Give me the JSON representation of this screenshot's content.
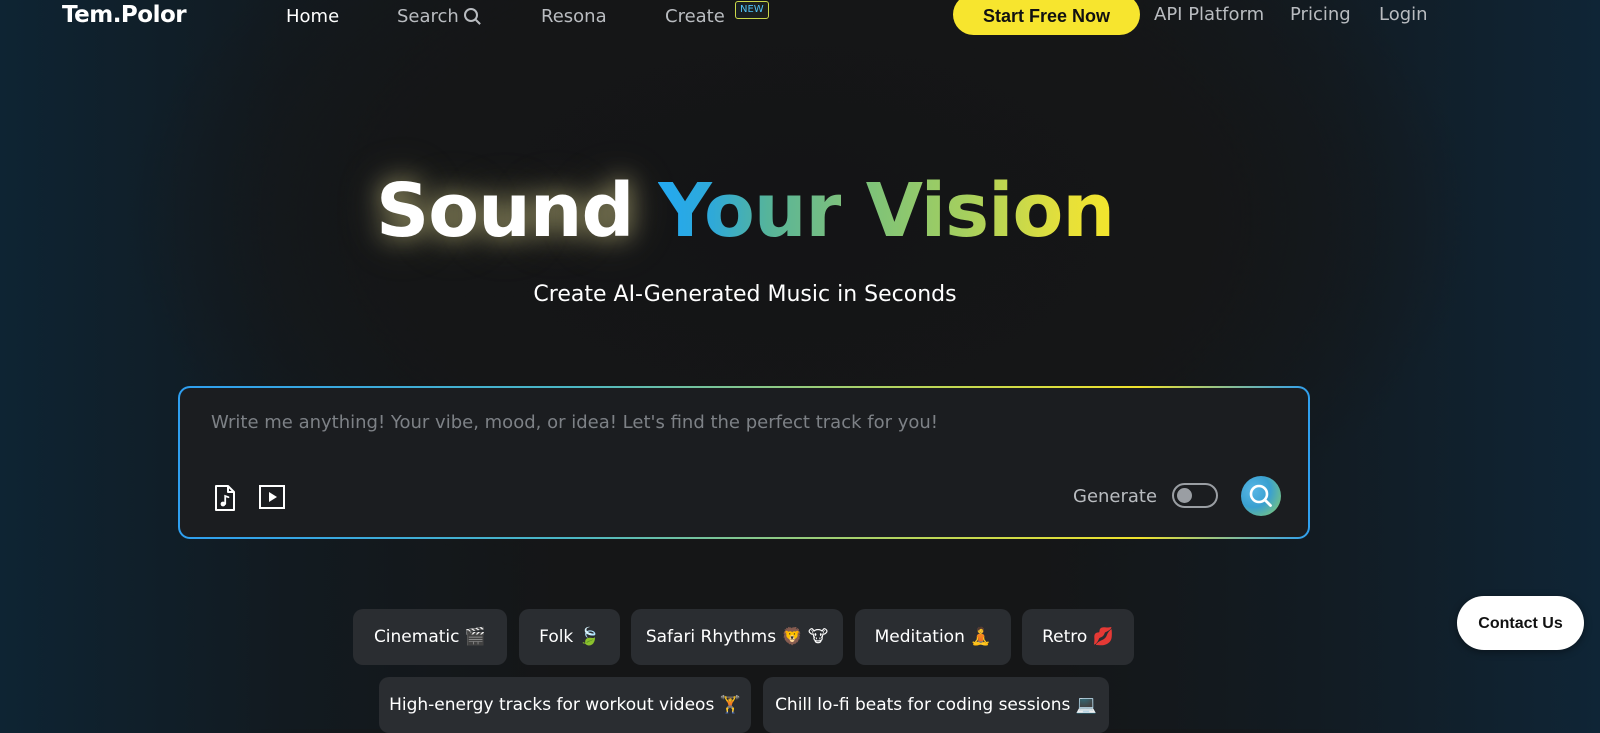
{
  "header": {
    "logo": "Tem.Polor",
    "nav": {
      "home": "Home",
      "search": "Search",
      "resona": "Resona",
      "create": "Create",
      "create_badge": "NEW"
    },
    "start_button": "Start Free Now",
    "api_platform": "API Platform",
    "pricing": "Pricing",
    "login": "Login"
  },
  "hero": {
    "title_word1": "Sound",
    "title_word2": "Your",
    "title_word3": "Vision",
    "subtitle": "Create AI-Generated Music in Seconds"
  },
  "prompt": {
    "placeholder": "Write me anything! Your vibe, mood, or idea! Let's find the perfect track for you!",
    "value": "",
    "generate_label": "Generate",
    "generate_enabled": false,
    "icons": {
      "music_file": "music-file-icon",
      "video": "video-play-icon",
      "search": "search-icon"
    }
  },
  "chips": [
    {
      "label": "Cinematic 🎬"
    },
    {
      "label": "Folk 🍃"
    },
    {
      "label": "Safari Rhythms 🦁 🐮"
    },
    {
      "label": "Meditation 🧘"
    },
    {
      "label": "Retro 💋"
    },
    {
      "label": "High-energy tracks for workout videos 🏋"
    },
    {
      "label": "Chill lo-fi beats for coding sessions 💻"
    }
  ],
  "contact_button": "Contact Us",
  "colors": {
    "accent_yellow": "#f7e52e",
    "accent_blue": "#23a9f2",
    "accent_green": "#7dc07d",
    "background": "#151617",
    "chip_background": "#2a2d31"
  }
}
